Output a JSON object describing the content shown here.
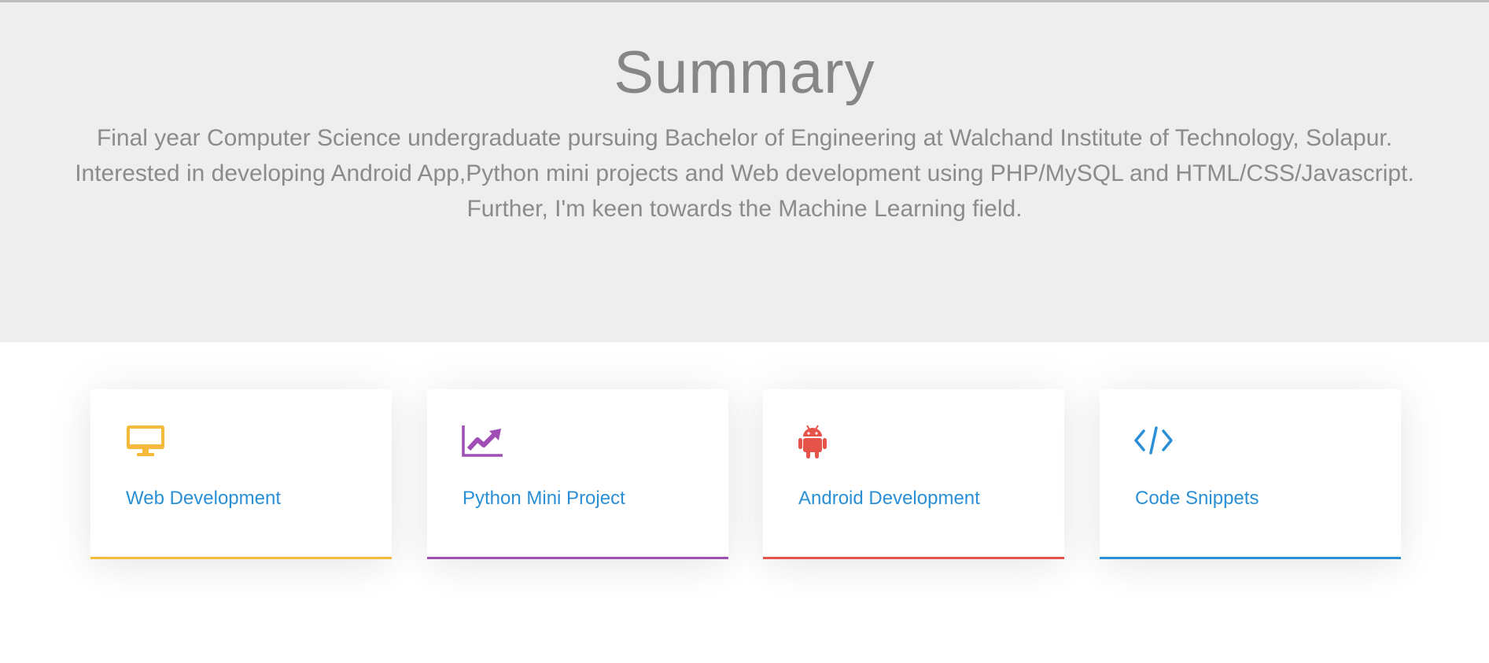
{
  "summary": {
    "heading": "Summary",
    "paragraph": "Final year Computer Science undergraduate pursuing Bachelor of Engineering at Walchand Institute of Technology, Solapur. Interested in developing Android App,Python mini projects and Web development using PHP/MySQL and HTML/CSS/Javascript.",
    "further": "Further, I'm keen towards the Machine Learning field."
  },
  "cards": [
    {
      "title": "Web Development",
      "icon": "monitor-icon",
      "color": "#f5b93c"
    },
    {
      "title": "Python Mini Project",
      "icon": "trend-chart-icon",
      "color": "#a04db4"
    },
    {
      "title": "Android Development",
      "icon": "android-icon",
      "color": "#e5534b"
    },
    {
      "title": "Code Snippets",
      "icon": "code-icon",
      "color": "#2b8fd6"
    }
  ]
}
